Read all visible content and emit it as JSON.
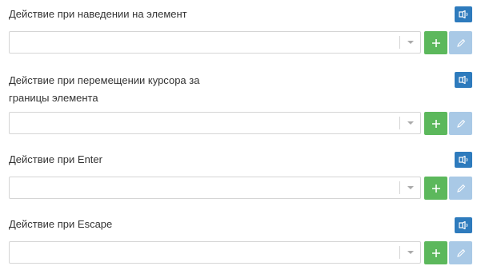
{
  "fields": [
    {
      "label": "Действие при наведении на элемент",
      "value": "",
      "info_icon": "info-speaker-icon",
      "add_icon": "plus-icon",
      "edit_icon": "pencil-icon"
    },
    {
      "label": "Действие при перемещении курсора за границы элемента",
      "value": "",
      "info_icon": "info-speaker-icon",
      "add_icon": "plus-icon",
      "edit_icon": "pencil-icon"
    },
    {
      "label": "Действие при Enter",
      "value": "",
      "info_icon": "info-speaker-icon",
      "add_icon": "plus-icon",
      "edit_icon": "pencil-icon"
    },
    {
      "label": "Действие при Escape",
      "value": "",
      "info_icon": "info-speaker-icon",
      "add_icon": "plus-icon",
      "edit_icon": "pencil-icon"
    }
  ],
  "colors": {
    "info_button": "#2e7bbd",
    "add_button": "#5cb85c",
    "edit_button_disabled": "#a9c9e6",
    "label_text": "#333333",
    "border": "#d5d5d5"
  }
}
